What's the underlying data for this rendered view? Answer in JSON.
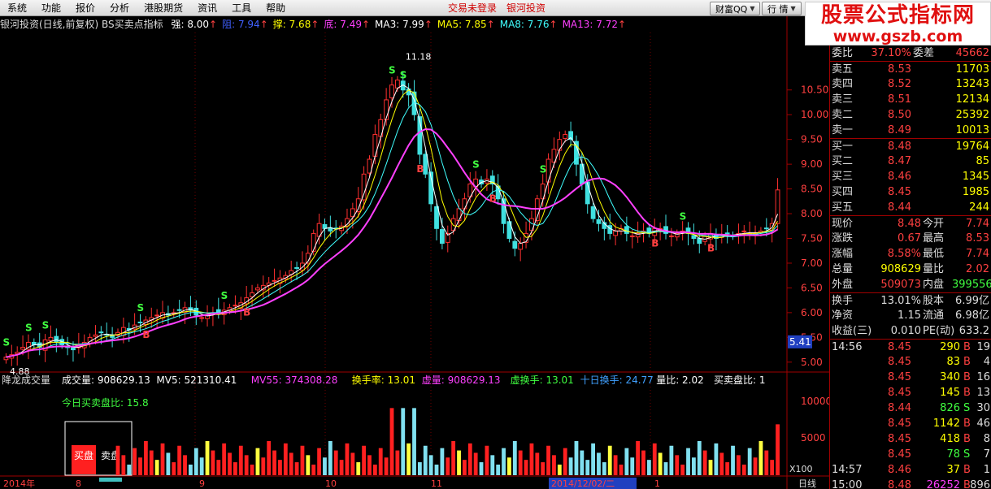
{
  "menu": {
    "items": [
      "系统",
      "功能",
      "报价",
      "分析",
      "港股期货",
      "资讯",
      "工具",
      "帮助"
    ],
    "status": "交易未登录",
    "broker": "银河投资",
    "buttons": [
      {
        "label": "财富QQ",
        "icon": "dropdown-arrow-icon"
      },
      {
        "label": "行 情",
        "icon": "dropdown-arrow-icon"
      }
    ]
  },
  "watermark": {
    "title": "股票公式指标网",
    "url": "www.gszb.com"
  },
  "main_header": {
    "title": "银河投资(日线,前复权) BS买卖点指标",
    "items": [
      {
        "label": "强: 8.00",
        "color": "#ffffff"
      },
      {
        "label": "阻: 7.94",
        "color": "#4060ff"
      },
      {
        "label": "撑: 7.68",
        "color": "#ffff00"
      },
      {
        "label": "底: 7.49",
        "color": "#ff40ff"
      },
      {
        "label": "MA3: 7.99",
        "color": "#ffffff"
      },
      {
        "label": "MA5: 7.85",
        "color": "#ffff00"
      },
      {
        "label": "MA8: 7.76",
        "color": "#40ffff"
      },
      {
        "label": "MA13: 7.72",
        "color": "#ff40ff"
      }
    ],
    "right_marks": "◇ ◻"
  },
  "price_axis": {
    "ticks": [
      "10.50",
      "10.00",
      "9.50",
      "9.00",
      "8.50",
      "8.00",
      "7.50",
      "7.00",
      "6.50",
      "6.00",
      "5.50",
      "5.00"
    ],
    "current": "5.41"
  },
  "annotations": {
    "high": "11.18",
    "low": "4.88"
  },
  "volume_header": {
    "title": "降龙成交量",
    "items": [
      {
        "label": "成交量: 908629.13",
        "color": "#ffffff"
      },
      {
        "label": "MV5: 521310.41",
        "color": "#ffffff"
      },
      {
        "label": "MV55: 374308.28",
        "color": "#ff40ff"
      },
      {
        "label": "换手率: 13.01",
        "color": "#ffff00"
      },
      {
        "label": "虚量: 908629.13",
        "color": "#ff40ff"
      },
      {
        "label": "虚换手: 13.01",
        "color": "#40ff40"
      },
      {
        "label": "十日换手: 24.77",
        "color": "#40a0ff"
      },
      {
        "label": "量比: 2.02",
        "color": "#ffffff"
      },
      {
        "label": "买卖盘比: 1",
        "color": "#ffffff"
      }
    ],
    "today_ratio": "今日买卖盘比: 15.8",
    "buy_label": "买盘",
    "sell_label": "卖盘",
    "axis": [
      "10000",
      "5000"
    ],
    "multiplier": "X100"
  },
  "time_axis": {
    "labels": [
      "2014年",
      "8",
      "9",
      "10",
      "11",
      "2014/12/02/二",
      "1"
    ],
    "period": "日线"
  },
  "quote": {
    "top_partial": {
      "l1": "委比",
      "v1": "37.10%",
      "l2": "委差",
      "v2": "45662"
    },
    "asks": [
      {
        "label": "卖五",
        "price": "8.53",
        "vol": "11703"
      },
      {
        "label": "卖四",
        "price": "8.52",
        "vol": "13243"
      },
      {
        "label": "卖三",
        "price": "8.51",
        "vol": "12134"
      },
      {
        "label": "卖二",
        "price": "8.50",
        "vol": "25392"
      },
      {
        "label": "卖一",
        "price": "8.49",
        "vol": "10013"
      }
    ],
    "bids": [
      {
        "label": "买一",
        "price": "8.48",
        "vol": "19764"
      },
      {
        "label": "买二",
        "price": "8.47",
        "vol": "85"
      },
      {
        "label": "买三",
        "price": "8.46",
        "vol": "1345"
      },
      {
        "label": "买四",
        "price": "8.45",
        "vol": "1985"
      },
      {
        "label": "买五",
        "price": "8.44",
        "vol": "244"
      }
    ],
    "stats": [
      {
        "l1": "现价",
        "v1": "8.48",
        "c1": "#ff4040",
        "l2": "今开",
        "v2": "7.74",
        "c2": "#ff4040"
      },
      {
        "l1": "涨跌",
        "v1": "0.67",
        "c1": "#ff4040",
        "l2": "最高",
        "v2": "8.53",
        "c2": "#ff4040"
      },
      {
        "l1": "涨幅",
        "v1": "8.58%",
        "c1": "#ff4040",
        "l2": "最低",
        "v2": "7.74",
        "c2": "#ff4040"
      },
      {
        "l1": "总量",
        "v1": "908629",
        "c1": "#ffff00",
        "l2": "量比",
        "v2": "2.02",
        "c2": "#ff4040"
      },
      {
        "l1": "外盘",
        "v1": "509073",
        "c1": "#ff4040",
        "l2": "内盘",
        "v2": "399556",
        "c2": "#40ff40"
      }
    ],
    "stats2": [
      {
        "l1": "换手",
        "v1": "13.01%",
        "l2": "股本",
        "v2": "6.99亿"
      },
      {
        "l1": "净资",
        "v1": "1.15",
        "l2": "流通",
        "v2": "6.98亿"
      },
      {
        "l1": "收益(三)",
        "v1": "0.010",
        "l2": "PE(动)",
        "v2": "633.2"
      }
    ],
    "ticks": [
      {
        "time": "14:56",
        "price": "8.45",
        "vol": "290",
        "dir": "B",
        "n": "19"
      },
      {
        "time": "",
        "price": "8.45",
        "vol": "83",
        "dir": "B",
        "n": "4"
      },
      {
        "time": "",
        "price": "8.45",
        "vol": "340",
        "dir": "B",
        "n": "16"
      },
      {
        "time": "",
        "price": "8.45",
        "vol": "145",
        "dir": "B",
        "n": "13"
      },
      {
        "time": "",
        "price": "8.44",
        "vol": "826",
        "dir": "S",
        "n": "30"
      },
      {
        "time": "",
        "price": "8.45",
        "vol": "1142",
        "dir": "B",
        "n": "46"
      },
      {
        "time": "",
        "price": "8.45",
        "vol": "418",
        "dir": "B",
        "n": "8"
      },
      {
        "time": "",
        "price": "8.45",
        "vol": "78",
        "dir": "S",
        "n": "7"
      },
      {
        "time": "14:57",
        "price": "8.46",
        "vol": "37",
        "dir": "B",
        "n": "1"
      },
      {
        "time": "15:00",
        "price": "8.48",
        "vol": "26252",
        "dir": "B",
        "n": "896"
      }
    ]
  },
  "chart_data": {
    "type": "candlestick",
    "title": "银河投资(日线,前复权) BS买卖点指标",
    "ylim": [
      4.8,
      11.3
    ],
    "close": [
      5.1,
      5.15,
      5.2,
      5.3,
      5.4,
      5.35,
      5.3,
      5.45,
      5.5,
      5.4,
      5.35,
      5.3,
      5.25,
      5.35,
      5.4,
      5.5,
      5.55,
      5.6,
      5.55,
      5.5,
      5.6,
      5.7,
      5.65,
      5.75,
      5.8,
      5.85,
      5.9,
      5.95,
      6.0,
      5.95,
      6.0,
      6.05,
      6.1,
      6.05,
      5.95,
      5.9,
      5.95,
      6.0,
      6.0,
      6.05,
      6.1,
      6.15,
      6.2,
      6.3,
      6.4,
      6.5,
      6.55,
      6.6,
      6.65,
      6.7,
      6.75,
      6.85,
      6.9,
      7.0,
      7.2,
      7.6,
      7.8,
      7.7,
      7.65,
      7.7,
      7.75,
      7.9,
      8.1,
      8.3,
      8.8,
      9.1,
      9.6,
      9.9,
      10.3,
      10.6,
      10.7,
      10.5,
      10.4,
      10.0,
      9.2,
      8.8,
      8.2,
      7.7,
      7.4,
      7.6,
      7.9,
      8.1,
      8.3,
      8.6,
      8.7,
      8.6,
      8.7,
      8.6,
      8.3,
      7.8,
      7.5,
      7.3,
      7.4,
      7.6,
      7.9,
      8.3,
      8.6,
      9.1,
      9.3,
      9.5,
      9.6,
      9.5,
      9.0,
      8.6,
      8.2,
      7.9,
      7.8,
      7.7,
      7.6,
      7.65,
      7.7,
      7.6,
      7.55,
      7.6,
      7.65,
      7.6,
      7.7,
      7.7,
      7.6,
      7.55,
      7.6,
      7.65,
      7.6,
      7.5,
      7.4,
      7.55,
      7.6,
      7.5,
      7.55,
      7.6,
      7.55,
      7.6,
      7.65,
      7.6,
      7.6,
      7.65,
      7.7,
      7.8,
      8.48
    ],
    "signals": [
      {
        "type": "S",
        "index": 0
      },
      {
        "type": "S",
        "index": 4
      },
      {
        "type": "S",
        "index": 7
      },
      {
        "type": "S",
        "index": 24
      },
      {
        "type": "B",
        "index": 25
      },
      {
        "type": "S",
        "index": 39
      },
      {
        "type": "B",
        "index": 43
      },
      {
        "type": "S",
        "index": 69
      },
      {
        "type": "S",
        "index": 71
      },
      {
        "type": "B",
        "index": 74
      },
      {
        "type": "S",
        "index": 84
      },
      {
        "type": "B",
        "index": 87
      },
      {
        "type": "S",
        "index": 96
      },
      {
        "type": "B",
        "index": 116
      },
      {
        "type": "S",
        "index": 121
      },
      {
        "type": "B",
        "index": 126
      }
    ]
  }
}
